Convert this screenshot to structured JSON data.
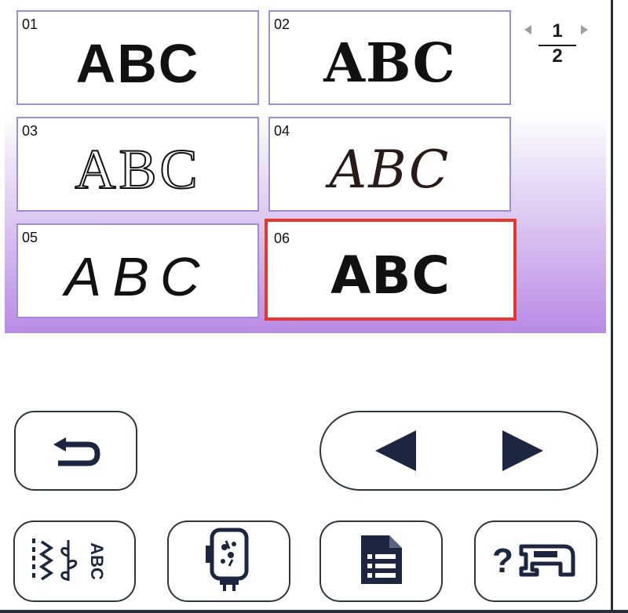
{
  "fonts": [
    {
      "number": "01",
      "sample": "ABC",
      "selected": false
    },
    {
      "number": "02",
      "sample": "ABC",
      "selected": false
    },
    {
      "number": "03",
      "sample": "ABC",
      "selected": false
    },
    {
      "number": "04",
      "sample": "ABC",
      "selected": false
    },
    {
      "number": "05",
      "sample": "ABC",
      "selected": false
    },
    {
      "number": "06",
      "sample": "ABC",
      "selected": true
    }
  ],
  "pagination": {
    "current": "1",
    "total": "2"
  },
  "toolbar": {
    "back_icon": "return-arrow-icon",
    "prev_icon": "triangle-left-icon",
    "next_icon": "triangle-right-icon"
  },
  "bottom_bar": {
    "pattern_type_icon": "pattern-category-icon",
    "pattern_type_label": "ABC",
    "embroidery_frame_icon": "embroidery-frame-icon",
    "memory_icon": "memory-file-icon",
    "help_icon": "machine-help-icon",
    "help_label": "?"
  },
  "colors": {
    "tile_border": "#9a8fd9",
    "selected_border": "#e7362c",
    "panel_gradient_end": "#b98ae6",
    "button_border": "#2f3440",
    "icon_navy": "#1d2640"
  }
}
